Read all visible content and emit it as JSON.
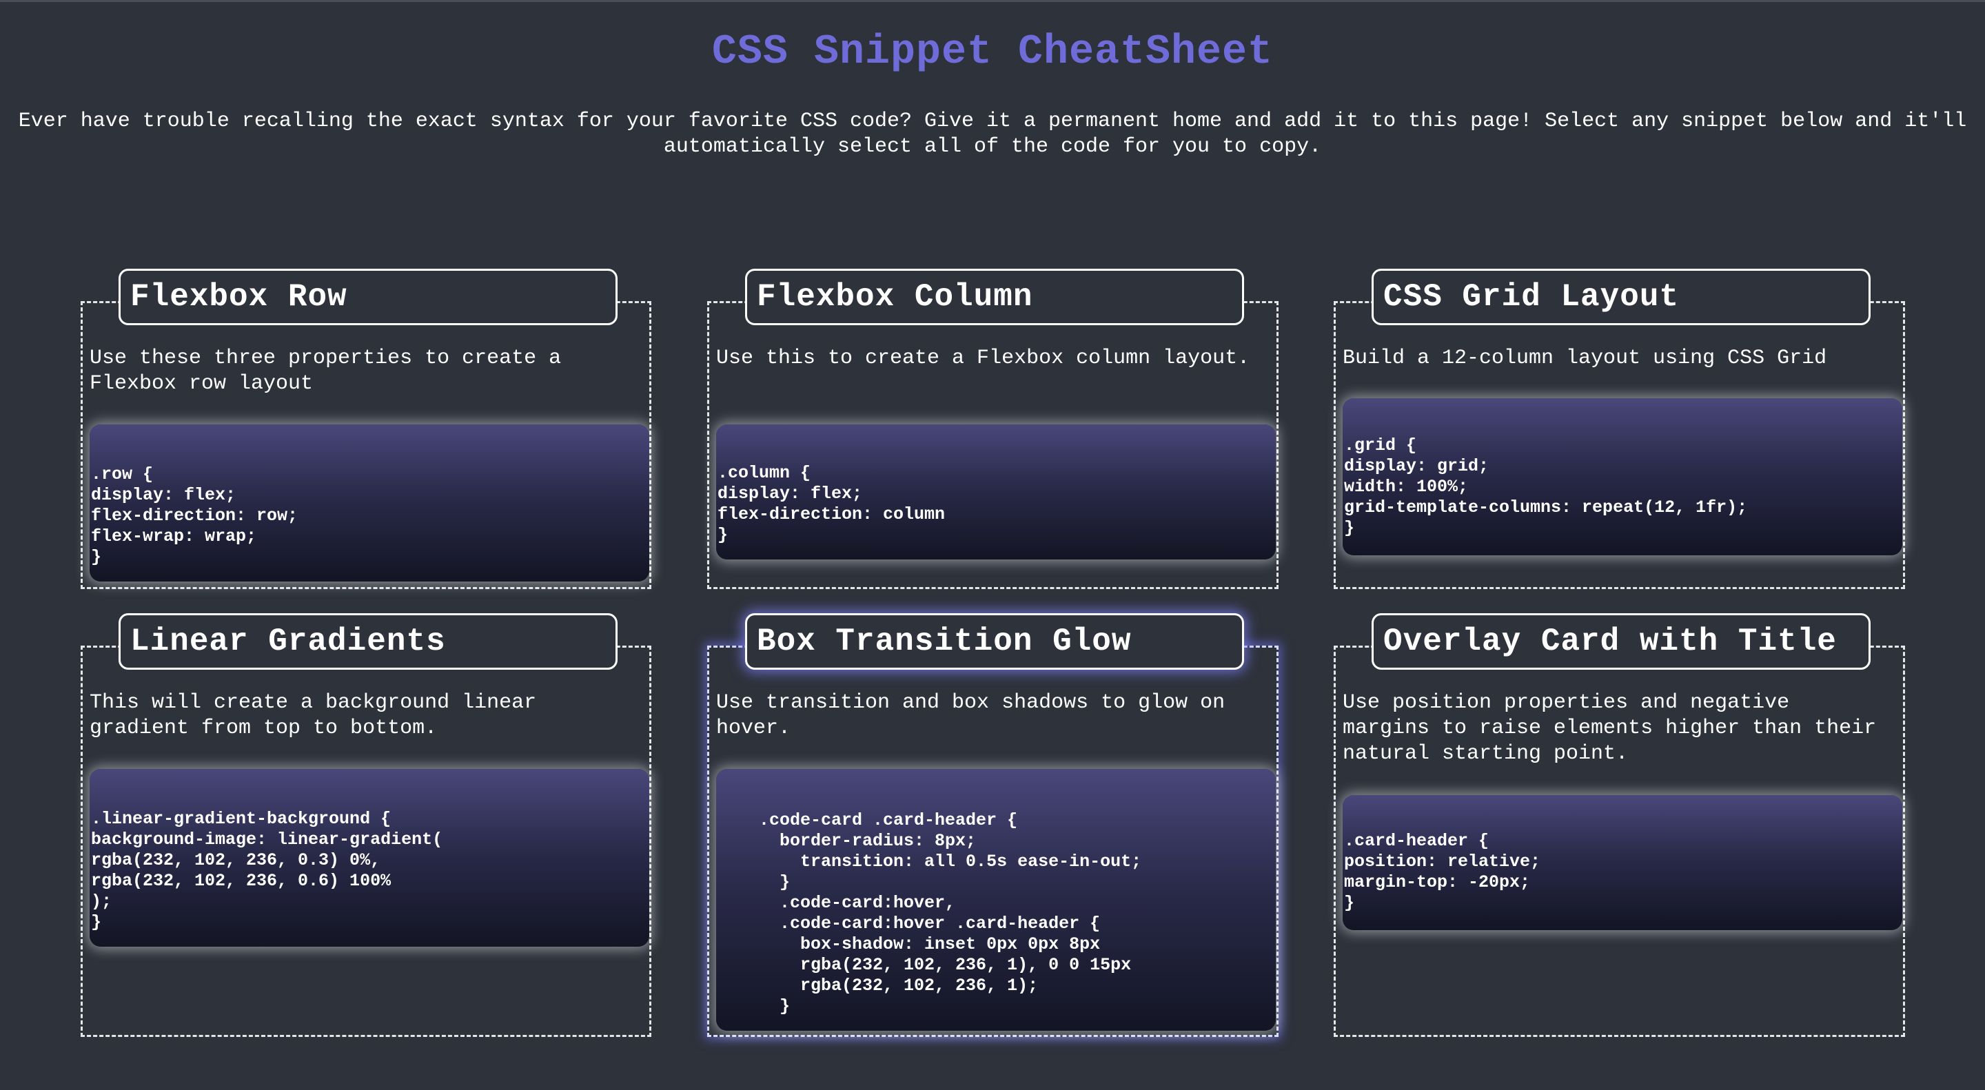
{
  "page": {
    "title": "CSS Snippet CheatSheet",
    "intro": "Ever have trouble recalling the exact syntax for your favorite CSS code? Give it a permanent home and add it to this page! Select any snippet below and it'll automatically select all of the code for you to copy."
  },
  "cards": [
    {
      "title": "Flexbox Row",
      "description": "Use these three properties to create a Flexbox row layout",
      "code": ".row {\ndisplay: flex;\nflex-direction: row;\nflex-wrap: wrap;\n}"
    },
    {
      "title": "Flexbox Column",
      "description": "Use this to create a Flexbox column layout.",
      "code": ".column {\ndisplay: flex;\nflex-direction: column\n}"
    },
    {
      "title": "CSS Grid Layout",
      "description": "Build a 12-column layout using CSS Grid",
      "code": ".grid {\ndisplay: grid;\nwidth: 100%;\ngrid-template-columns: repeat(12, 1fr);\n}"
    },
    {
      "title": "Linear Gradients",
      "description": "This will create a background linear gradient from top to bottom.",
      "code": ".linear-gradient-background {\nbackground-image: linear-gradient(\nrgba(232, 102, 236, 0.3) 0%,\nrgba(232, 102, 236, 0.6) 100%\n);\n}"
    },
    {
      "title": "Box Transition Glow",
      "description": "Use transition and box shadows to glow on hover.",
      "code": "    .code-card .card-header {\n      border-radius: 8px;\n        transition: all 0.5s ease-in-out;\n      }\n      .code-card:hover,\n      .code-card:hover .card-header {\n        box-shadow: inset 0px 0px 8px\n        rgba(232, 102, 236, 1), 0 0 15px\n        rgba(232, 102, 236, 1);\n      }"
    },
    {
      "title": "Overlay Card with Title",
      "description": "Use position properties and negative margins to raise elements higher than their natural starting point.",
      "code": ".card-header {\nposition: relative;\nmargin-top: -20px;\n}"
    }
  ]
}
